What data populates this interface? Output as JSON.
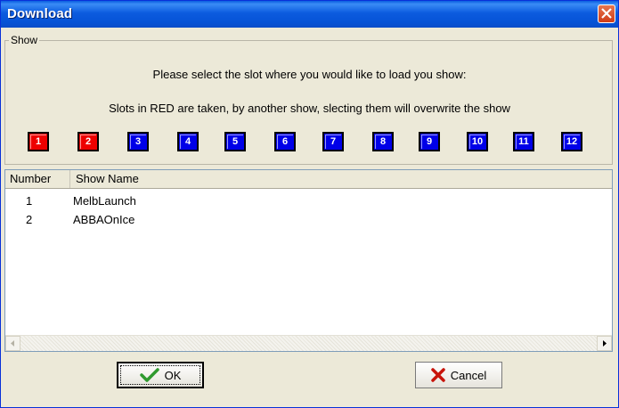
{
  "window": {
    "title": "Download"
  },
  "group": {
    "legend": "Show"
  },
  "messages": {
    "line1": "Please select the slot where you would like to load you show:",
    "line2": "Slots in RED are taken, by another show, slecting them will overwrite the show"
  },
  "slots": [
    {
      "label": "1",
      "status": "taken",
      "color": "#ee0000"
    },
    {
      "label": "2",
      "status": "taken",
      "color": "#ee0000"
    },
    {
      "label": "3",
      "status": "free",
      "color": "#0000e8"
    },
    {
      "label": "4",
      "status": "free",
      "color": "#0000e8"
    },
    {
      "label": "5",
      "status": "free",
      "color": "#0000e8"
    },
    {
      "label": "6",
      "status": "free",
      "color": "#0000e8"
    },
    {
      "label": "7",
      "status": "free",
      "color": "#0000e8"
    },
    {
      "label": "8",
      "status": "free",
      "color": "#0000e8"
    },
    {
      "label": "9",
      "status": "free",
      "color": "#0000e8"
    },
    {
      "label": "10",
      "status": "free",
      "color": "#0000e8"
    },
    {
      "label": "11",
      "status": "free",
      "color": "#0000e8"
    },
    {
      "label": "12",
      "status": "free",
      "color": "#0000e8"
    }
  ],
  "list": {
    "columns": [
      "Number",
      "Show Name"
    ],
    "rows": [
      {
        "number": "1",
        "name": "MelbLaunch"
      },
      {
        "number": "2",
        "name": "ABBAOnIce"
      }
    ]
  },
  "buttons": {
    "ok": "OK",
    "cancel": "Cancel"
  },
  "icons": {
    "close": "close-icon",
    "ok": "checkmark-icon",
    "cancel": "red-x-icon"
  }
}
